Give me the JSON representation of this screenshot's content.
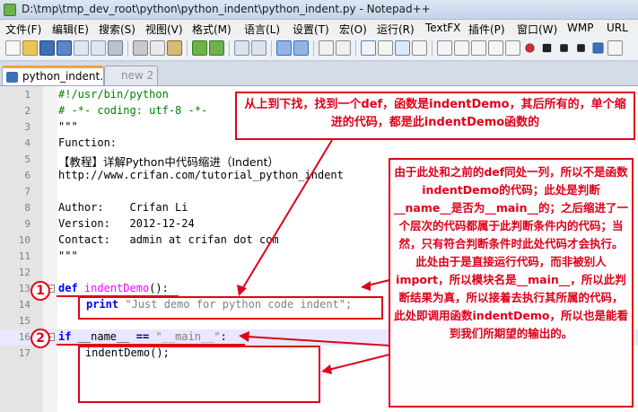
{
  "window": {
    "title": "D:\\tmp\\tmp_dev_root\\python\\python_indent\\python_indent.py - Notepad++"
  },
  "menu": [
    "文件(F)",
    "编辑(E)",
    "搜索(S)",
    "视图(V)",
    "格式(M)",
    "语言(L)",
    "设置(T)",
    "宏(O)",
    "运行(R)",
    "TextFX",
    "插件(P)",
    "窗口(W)",
    "WMP",
    "URL"
  ],
  "tabs": [
    {
      "label": "python_indent.py",
      "active": true
    },
    {
      "label": "new 2",
      "active": false
    }
  ],
  "code_lines": [
    {
      "no": "1",
      "text": "#!/usr/bin/python"
    },
    {
      "no": "2",
      "text": "# -*- coding: utf-8 -*-"
    },
    {
      "no": "3",
      "text": "\"\"\""
    },
    {
      "no": "4",
      "text": "Function:"
    },
    {
      "no": "5",
      "text": "【教程】详解Python中代码缩进（Indent）"
    },
    {
      "no": "6",
      "text": "http://www.crifan.com/tutorial_python_indent"
    },
    {
      "no": "7",
      "text": ""
    },
    {
      "no": "8",
      "text": "Author:    Crifan Li"
    },
    {
      "no": "9",
      "text": "Version:   2012-12-24"
    },
    {
      "no": "10",
      "text": "Contact:   admin at crifan dot com"
    },
    {
      "no": "11",
      "text": "\"\"\""
    },
    {
      "no": "12",
      "text": ""
    },
    {
      "no": "13",
      "kw": "def",
      "name": "indentDemo",
      "rest": "():"
    },
    {
      "no": "14",
      "kw": "print",
      "str": "\"Just demo for python code indent\";"
    },
    {
      "no": "15",
      "text": ""
    },
    {
      "no": "16",
      "kw": "if",
      "cond": "__name__",
      "op": "==",
      "str": "\"__main__\"",
      "end": ":"
    },
    {
      "no": "17",
      "text": "    indentDemo();"
    }
  ],
  "annotations": {
    "top": "从上到下找，找到一个def，函数是indentDemo，其后所有的，单个缩进的代码，都是此indentDemo函数的",
    "side": "由于此处和之前的def同处一列，所以不是函数indentDemo的代码；此处是判断__name__是否为__main__的；之后缩进了一个层次的代码都属于此判断条件内的代码；当然，只有符合判断条件时此处代码才会执行。此处由于是直接运行代码，而非被别人import，所以模块名是__main__，所以此判断结果为真，所以接着去执行其所属的代码，此处即调用函数indentDemo，所以也是能看到我们所期望的输出的。",
    "badge1": "1",
    "badge2": "2"
  },
  "colors": {
    "accent": "#e0001a",
    "keyword": "#0000ff",
    "comment": "#008000",
    "string": "#808080",
    "function": "#ff00ff"
  },
  "icons": [
    "new-icon",
    "open-icon",
    "save-icon",
    "save-all-icon",
    "close-icon",
    "close-all-icon",
    "print-icon",
    "cut-icon",
    "copy-icon",
    "paste-icon",
    "undo-icon",
    "redo-icon",
    "find-icon",
    "replace-icon",
    "zoom-in-icon",
    "zoom-out-icon",
    "sync-v-icon",
    "sync-h-icon",
    "wrap-icon",
    "all-chars-icon",
    "indent-guide-icon",
    "doc-map-icon",
    "record-macro-icon",
    "stop-macro-icon",
    "play-macro-icon",
    "run-macro-icon",
    "save-macro-icon"
  ]
}
